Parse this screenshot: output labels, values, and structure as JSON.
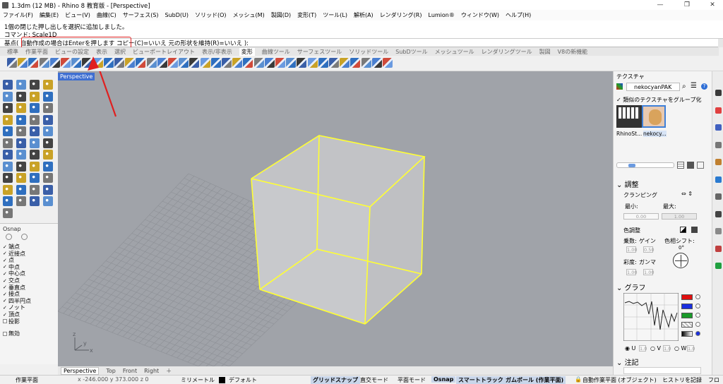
{
  "window": {
    "title": "1.3dm (12 MB) - Rhino 8 教育版 - [Perspective]",
    "minimize": "—",
    "restore": "❐",
    "close": "✕"
  },
  "menu": [
    "ファイル(F)",
    "編集(E)",
    "ビュー(V)",
    "曲線(C)",
    "サーフェス(S)",
    "SubD(U)",
    "ソリッド(O)",
    "メッシュ(M)",
    "製図(D)",
    "変形(T)",
    "ツール(L)",
    "解析(A)",
    "レンダリング(R)",
    "Lumion®",
    "ウィンドウ(W)",
    "ヘルプ(H)"
  ],
  "command_history": {
    "line1": "1個の閉じた押し出しを選択に追加しました。",
    "line2": "コマンド: Scale1D"
  },
  "command_prompt": {
    "prefix": "基点",
    "highlighted": "( 自動作成の場合はEnterを押します",
    "suffix": " コピー(C)=いいえ  元の形状を維持(R)=いいえ ):"
  },
  "toolbar_tabs": [
    "標準",
    "作業平面",
    "ビューの設定",
    "表示",
    "選択",
    "ビューポートレイアウト",
    "表示/非表示",
    "変形",
    "曲線ツール",
    "サーフェスツール",
    "ソリッドツール",
    "SubDツール",
    "メッシュツール",
    "レンダリングツール",
    "製図",
    "V8の新機能"
  ],
  "active_toolbar_tab": "変形",
  "osnap": {
    "header": "Osnap",
    "items": [
      {
        "label": "端点",
        "checked": true
      },
      {
        "label": "近接点",
        "checked": true
      },
      {
        "label": "点",
        "checked": true
      },
      {
        "label": "中点",
        "checked": true
      },
      {
        "label": "中心点",
        "checked": true
      },
      {
        "label": "交点",
        "checked": true
      },
      {
        "label": "垂直点",
        "checked": true
      },
      {
        "label": "接点",
        "checked": true
      },
      {
        "label": "四半円点",
        "checked": true
      },
      {
        "label": "ノット",
        "checked": true
      },
      {
        "label": "頂点",
        "checked": true
      },
      {
        "label": "投影",
        "checked": false
      },
      {
        "label": "無効",
        "checked": false
      }
    ]
  },
  "viewport": {
    "title": "Perspective",
    "axis_x": "x",
    "axis_y": "y",
    "axis_z": "z"
  },
  "viewport_tabs": [
    "Perspective",
    "Top",
    "Front",
    "Right",
    "＋"
  ],
  "active_viewport_tab": "Perspective",
  "texture_panel": {
    "title": "テクスチャ",
    "texture_name": "nekocyanPAK",
    "group_label": "類似のテクスチャをグループ化",
    "thumbnails": [
      "RhinoSt...",
      "nekocy..."
    ],
    "adjust_header": "調整",
    "clamping": "クランピング",
    "min_label": "最小:",
    "max_label": "最大:",
    "min_value": "0.00",
    "max_value": "1.00",
    "color_adjust": "色調整",
    "multiply": "乗数:",
    "gain": "ゲイン",
    "hue_shift": "色相シフト:",
    "hue_angle": "0°",
    "saturation": "彩度:",
    "gamma": "ガンマ",
    "val_1": "1.00",
    "val_2": "0.50",
    "val_3": "1.00",
    "val_4": "1.00",
    "graph_header": "グラフ",
    "radio_u": "U",
    "radio_v": "V",
    "radio_w": "W",
    "uvw_value": "1.0",
    "notes_header": "注記",
    "graph_colors": [
      "#e01010",
      "#1a2fe0",
      "#1a9a2a",
      "#ffffff",
      "#333333"
    ]
  },
  "status_bar": {
    "workplane": "作業平面",
    "coords": "x -246.000   y 373.000   z 0",
    "units": "ミリメートル",
    "layer": "デフォルト",
    "grid_snap": "グリッドスナップ",
    "ortho": "直交モード",
    "planar": "平面モード",
    "osnap": "Osnap",
    "smart_track": "スマートトラック",
    "gumball": "ガムボール (作業平面)",
    "auto_cplane": "自動作業平面 (オブジェクト)",
    "history": "ヒストリを記録",
    "filter": "フロ"
  },
  "colors": {
    "selection_yellow": "#ffff33",
    "viewport_bg": "#a0a3a9",
    "highlight_red": "#e02020",
    "viewport_title_blue": "#3f6fd1"
  }
}
